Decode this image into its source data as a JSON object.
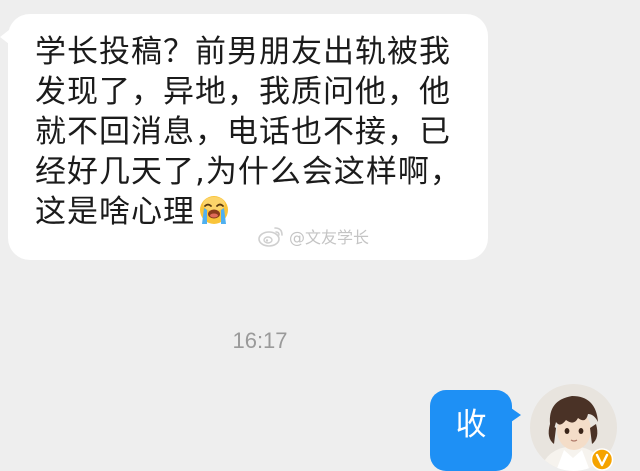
{
  "conversation": {
    "incoming_message": {
      "lines": [
        "学长投稿？前男朋友出轨被我",
        "发现了，异地，我质问他，他",
        "就不回消息，电话也不接，已",
        "经好几天了,为什么会这样啊，",
        "这是啥心理"
      ],
      "emoji": "crying-face-emoji"
    },
    "watermark": {
      "icon": "weibo-icon",
      "text": "@文友学长"
    },
    "timestamp": "16:17",
    "outgoing_message": {
      "text": "收"
    },
    "avatar": {
      "icon": "user-avatar",
      "badge": "verified-badge-icon"
    }
  },
  "colors": {
    "background": "#eeeeee",
    "incoming_bubble": "#ffffff",
    "outgoing_bubble": "#1e90f5",
    "timestamp_text": "#9a9a9a",
    "badge": "#f5a300"
  }
}
